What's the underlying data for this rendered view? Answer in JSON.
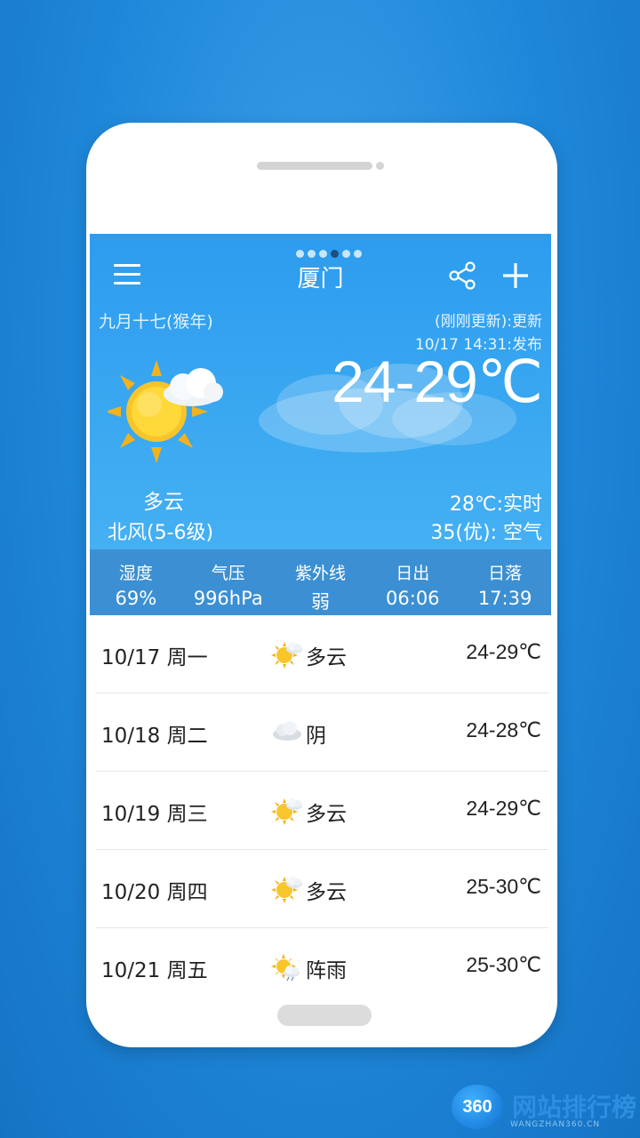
{
  "header": {
    "city": "厦门",
    "page_dots": 6,
    "active_dot": 3
  },
  "current": {
    "lunar_date": "九月十七(猴年)",
    "update_status": "(刚刚更新):更新",
    "publish_time": "10/17 14:31:发布",
    "temp_range": "24-29℃",
    "condition": "多云",
    "wind": "北风(5-6级)",
    "realtime_temp": "28℃:实时",
    "air_quality": "35(优): 空气"
  },
  "stats": [
    {
      "label": "湿度",
      "value": "69%"
    },
    {
      "label": "气压",
      "value": "996hPa"
    },
    {
      "label": "紫外线",
      "value": "弱"
    },
    {
      "label": "日出",
      "value": "06:06"
    },
    {
      "label": "日落",
      "value": "17:39"
    }
  ],
  "forecast": [
    {
      "date": "10/17 周一",
      "icon": "partly-cloudy-icon",
      "weather": "多云",
      "range": "24-29℃"
    },
    {
      "date": "10/18 周二",
      "icon": "overcast-icon",
      "weather": "阴",
      "range": "24-28℃"
    },
    {
      "date": "10/19 周三",
      "icon": "partly-cloudy-icon",
      "weather": "多云",
      "range": "24-29℃"
    },
    {
      "date": "10/20 周四",
      "icon": "partly-cloudy-icon",
      "weather": "多云",
      "range": "25-30℃"
    },
    {
      "date": "10/21 周五",
      "icon": "shower-icon",
      "weather": "阵雨",
      "range": "25-30℃"
    }
  ],
  "watermark": {
    "badge": "360",
    "title": "网站排行榜",
    "sub": "WANGZHAN360.CN"
  },
  "colors": {
    "background": "#1e86d8",
    "hero": "#37a5f0",
    "stats_bar": "#3c8fd2",
    "text_dark": "#222222"
  }
}
